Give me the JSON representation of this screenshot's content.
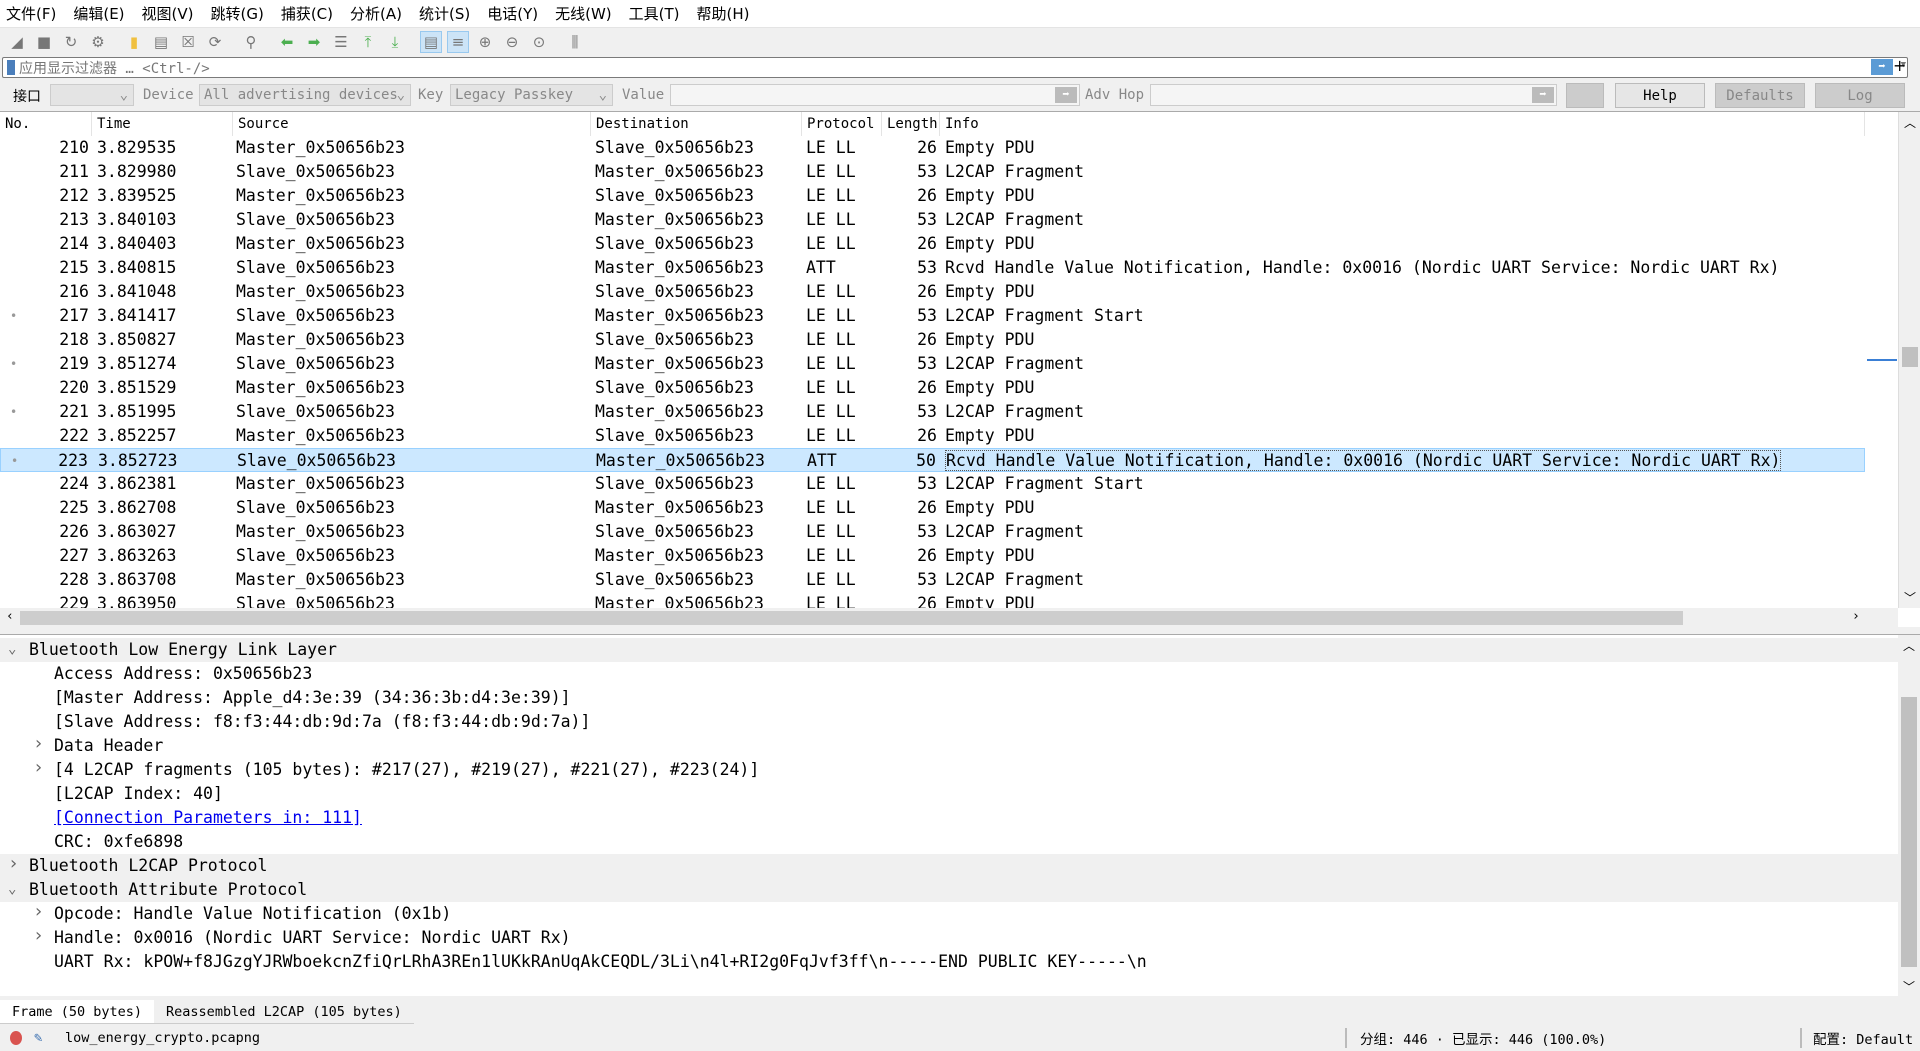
{
  "menu": [
    "文件(F)",
    "编辑(E)",
    "视图(V)",
    "跳转(G)",
    "捕获(C)",
    "分析(A)",
    "统计(S)",
    "电话(Y)",
    "无线(W)",
    "工具(T)",
    "帮助(H)"
  ],
  "toolbar": [
    "start-capture",
    "stop-capture",
    "restart-capture",
    "capture-options",
    "open-file",
    "save-file",
    "close-file",
    "reload-file",
    "find-packet",
    "go-back",
    "go-forward",
    "go-to-packet",
    "go-first",
    "go-last",
    "auto-scroll",
    "colorize",
    "zoom-in",
    "zoom-out",
    "zoom-normal",
    "resize-columns"
  ],
  "filter": {
    "placeholder": "应用显示过滤器 … <Ctrl-/>"
  },
  "ctrl": {
    "interface_label": "接口",
    "interface_value": "",
    "device_label": "Device",
    "device_value": "All advertising devices",
    "key_label": "Key",
    "key_value": "Legacy Passkey",
    "value_label": "Value",
    "value_value": "",
    "advhop_label": "Adv Hop",
    "advhop_value": "",
    "help": "Help",
    "defaults": "Defaults",
    "log": "Log"
  },
  "columns": [
    "No.",
    "Time",
    "Source",
    "Destination",
    "Protocol",
    "Length",
    "Info"
  ],
  "packets": [
    [
      "210",
      "3.829535",
      "Master_0x50656b23",
      "Slave_0x50656b23",
      "LE LL",
      "26",
      "Empty PDU",
      false
    ],
    [
      "211",
      "3.829980",
      "Slave_0x50656b23",
      "Master_0x50656b23",
      "LE LL",
      "53",
      "L2CAP Fragment",
      false
    ],
    [
      "212",
      "3.839525",
      "Master_0x50656b23",
      "Slave_0x50656b23",
      "LE LL",
      "26",
      "Empty PDU",
      false
    ],
    [
      "213",
      "3.840103",
      "Slave_0x50656b23",
      "Master_0x50656b23",
      "LE LL",
      "53",
      "L2CAP Fragment",
      false
    ],
    [
      "214",
      "3.840403",
      "Master_0x50656b23",
      "Slave_0x50656b23",
      "LE LL",
      "26",
      "Empty PDU",
      false
    ],
    [
      "215",
      "3.840815",
      "Slave_0x50656b23",
      "Master_0x50656b23",
      "ATT",
      "53",
      "Rcvd Handle Value Notification, Handle: 0x0016 (Nordic UART Service: Nordic UART Rx)",
      false
    ],
    [
      "216",
      "3.841048",
      "Master_0x50656b23",
      "Slave_0x50656b23",
      "LE LL",
      "26",
      "Empty PDU",
      false
    ],
    [
      "217",
      "3.841417",
      "Slave_0x50656b23",
      "Master_0x50656b23",
      "LE LL",
      "53",
      "L2CAP Fragment Start",
      true
    ],
    [
      "218",
      "3.850827",
      "Master_0x50656b23",
      "Slave_0x50656b23",
      "LE LL",
      "26",
      "Empty PDU",
      false
    ],
    [
      "219",
      "3.851274",
      "Slave_0x50656b23",
      "Master_0x50656b23",
      "LE LL",
      "53",
      "L2CAP Fragment",
      true
    ],
    [
      "220",
      "3.851529",
      "Master_0x50656b23",
      "Slave_0x50656b23",
      "LE LL",
      "26",
      "Empty PDU",
      false
    ],
    [
      "221",
      "3.851995",
      "Slave_0x50656b23",
      "Master_0x50656b23",
      "LE LL",
      "53",
      "L2CAP Fragment",
      true
    ],
    [
      "222",
      "3.852257",
      "Master_0x50656b23",
      "Slave_0x50656b23",
      "LE LL",
      "26",
      "Empty PDU",
      false
    ],
    [
      "223",
      "3.852723",
      "Slave_0x50656b23",
      "Master_0x50656b23",
      "ATT",
      "50",
      "Rcvd Handle Value Notification, Handle: 0x0016 (Nordic UART Service: Nordic UART Rx)",
      true
    ],
    [
      "224",
      "3.862381",
      "Master_0x50656b23",
      "Slave_0x50656b23",
      "LE LL",
      "53",
      "L2CAP Fragment Start",
      false
    ],
    [
      "225",
      "3.862708",
      "Slave_0x50656b23",
      "Master_0x50656b23",
      "LE LL",
      "26",
      "Empty PDU",
      false
    ],
    [
      "226",
      "3.863027",
      "Master_0x50656b23",
      "Slave_0x50656b23",
      "LE LL",
      "53",
      "L2CAP Fragment",
      false
    ],
    [
      "227",
      "3.863263",
      "Slave_0x50656b23",
      "Master_0x50656b23",
      "LE LL",
      "26",
      "Empty PDU",
      false
    ],
    [
      "228",
      "3.863708",
      "Master_0x50656b23",
      "Slave_0x50656b23",
      "LE LL",
      "53",
      "L2CAP Fragment",
      false
    ],
    [
      "229",
      "3.863950",
      "Slave_0x50656b23",
      "Master_0x50656b23",
      "LE LL",
      "26",
      "Empty PDU",
      false
    ]
  ],
  "selected_packet": "223",
  "details": [
    {
      "text": "Bluetooth Low Energy Link Layer",
      "level": 0,
      "expander": "open",
      "section": true
    },
    {
      "text": "Access Address: 0x50656b23",
      "level": 1
    },
    {
      "text": "[Master Address: Apple_d4:3e:39 (34:36:3b:d4:3e:39)]",
      "level": 1
    },
    {
      "text": "[Slave Address: f8:f3:44:db:9d:7a (f8:f3:44:db:9d:7a)]",
      "level": 1
    },
    {
      "text": "Data Header",
      "level": 1,
      "expander": "closed"
    },
    {
      "text": "[4 L2CAP fragments (105 bytes): #217(27), #219(27), #221(27), #223(24)]",
      "level": 1,
      "expander": "closed"
    },
    {
      "text": "[L2CAP Index: 40]",
      "level": 1
    },
    {
      "text": "[Connection Parameters in: 111]",
      "level": 1,
      "link": true
    },
    {
      "text": "CRC: 0xfe6898",
      "level": 1
    },
    {
      "text": "Bluetooth L2CAP Protocol",
      "level": 0,
      "expander": "closed",
      "section": true
    },
    {
      "text": "Bluetooth Attribute Protocol",
      "level": 0,
      "expander": "open",
      "section": true
    },
    {
      "text": "Opcode: Handle Value Notification (0x1b)",
      "level": 1,
      "expander": "closed"
    },
    {
      "text": "Handle: 0x0016 (Nordic UART Service: Nordic UART Rx)",
      "level": 1,
      "expander": "closed"
    },
    {
      "text": "UART Rx: kPOW+f8JGzgYJRWboekcnZfiQrLRhA3REn1lUKkRAnUqAkCEQDL/3Li\\n4l+RI2g0FqJvf3ff\\n-----END PUBLIC KEY-----\\n",
      "level": 1
    }
  ],
  "bytes_tabs": [
    "Frame (50 bytes)",
    "Reassembled L2CAP (105 bytes)"
  ],
  "status": {
    "file": "low_energy_crypto.pcapng",
    "packets": "分组: 446 · 已显示: 446 (100.0%)",
    "profile": "配置: Default"
  },
  "colors": {
    "selection": "#cce8ff",
    "link": "#0000ee",
    "capture_stopped": "#d9534f"
  }
}
